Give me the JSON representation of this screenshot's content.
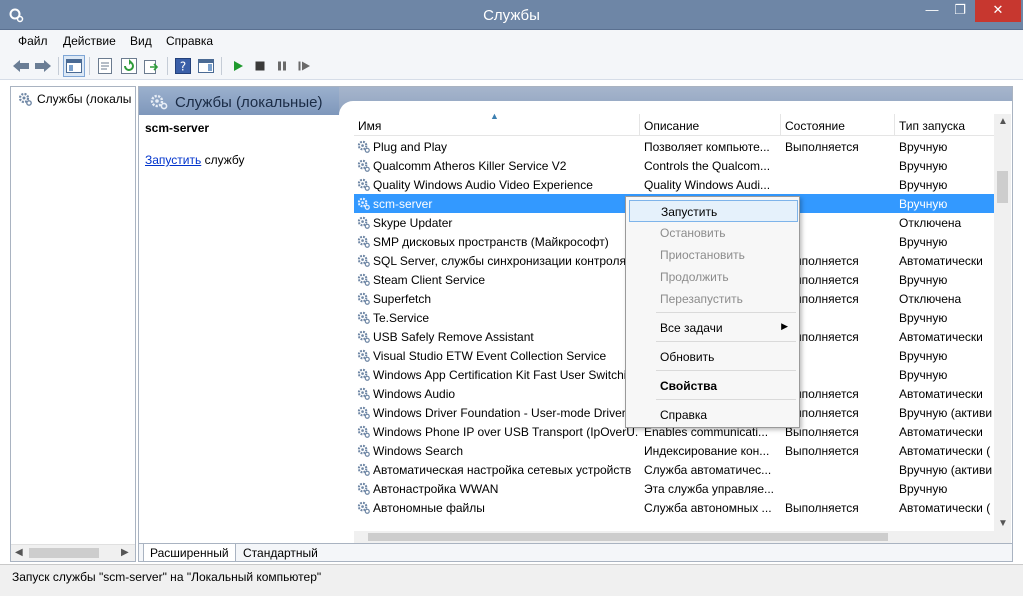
{
  "window": {
    "title": "Службы",
    "minimize": "—",
    "maximize": "❐",
    "close": "✕"
  },
  "menu": [
    "Файл",
    "Действие",
    "Вид",
    "Справка"
  ],
  "tree": {
    "item": "Службы (локалы"
  },
  "main": {
    "header_title": "Службы (локальные)",
    "selected_service": "scm-server",
    "action_link": "Запустить",
    "action_suffix": " службу"
  },
  "columns": {
    "name": "Имя",
    "desc": "Описание",
    "state": "Состояние",
    "startup": "Тип запуска"
  },
  "rows": [
    {
      "name": "Plug and Play",
      "desc": "Позволяет компьюте...",
      "state": "Выполняется",
      "startup": "Вручную"
    },
    {
      "name": "Qualcomm Atheros Killer Service V2",
      "desc": "Controls the Qualcom...",
      "state": "",
      "startup": "Вручную"
    },
    {
      "name": "Quality Windows Audio Video Experience",
      "desc": "Quality Windows Audi...",
      "state": "",
      "startup": "Вручную"
    },
    {
      "name": "scm-server",
      "desc": "",
      "state": "",
      "startup": "Вручную"
    },
    {
      "name": "Skype Updater",
      "desc": "",
      "state": "",
      "startup": "Отключена"
    },
    {
      "name": "SMP дисковых пространств (Майкрософт)",
      "desc": "",
      "state": "",
      "startup": "Вручную"
    },
    {
      "name": "SQL Server, службы синхронизации контроля",
      "desc": "",
      "state": "Выполняется",
      "startup": "Автоматически"
    },
    {
      "name": "Steam Client Service",
      "desc": "",
      "state": "Выполняется",
      "startup": "Вручную"
    },
    {
      "name": "Superfetch",
      "desc": "",
      "state": "Выполняется",
      "startup": "Отключена"
    },
    {
      "name": "Te.Service",
      "desc": "",
      "state": "",
      "startup": "Вручную"
    },
    {
      "name": "USB Safely Remove Assistant",
      "desc": "",
      "state": "Выполняется",
      "startup": "Автоматически"
    },
    {
      "name": "Visual Studio ETW Event Collection Service",
      "desc": "",
      "state": "",
      "startup": "Вручную"
    },
    {
      "name": "Windows App Certification Kit Fast User Switchi...",
      "desc": "",
      "state": "",
      "startup": "Вручную"
    },
    {
      "name": "Windows Audio",
      "desc": "",
      "state": "Выполняется",
      "startup": "Автоматически"
    },
    {
      "name": "Windows Driver Foundation - User-mode Driver ...",
      "desc": "",
      "state": "Выполняется",
      "startup": "Вручную (активи"
    },
    {
      "name": "Windows Phone IP over USB Transport (IpOverU...",
      "desc": "Enables communicati...",
      "state": "Выполняется",
      "startup": "Автоматически"
    },
    {
      "name": "Windows Search",
      "desc": "Индексирование кон...",
      "state": "Выполняется",
      "startup": "Автоматически ("
    },
    {
      "name": "Автоматическая настройка сетевых устройств",
      "desc": "Служба автоматичес...",
      "state": "",
      "startup": "Вручную (активи"
    },
    {
      "name": "Автонастройка WWAN",
      "desc": "Эта служба управляе...",
      "state": "",
      "startup": "Вручную"
    },
    {
      "name": "Автономные файлы",
      "desc": "Служба автономных ...",
      "state": "Выполняется",
      "startup": "Автоматически ("
    }
  ],
  "context_menu": {
    "start": "Запустить",
    "stop": "Остановить",
    "pause": "Приостановить",
    "resume": "Продолжить",
    "restart": "Перезапустить",
    "all_tasks": "Все задачи",
    "refresh": "Обновить",
    "properties": "Свойства",
    "help": "Справка"
  },
  "bottom_tabs": [
    "Расширенный",
    "Стандартный"
  ],
  "status": "Запуск службы \"scm-server\" на \"Локальный компьютер\"",
  "colors": {
    "title_bar": "#6e86a6",
    "close": "#c7372f",
    "selection": "#3399ff",
    "link": "#0033cc"
  }
}
